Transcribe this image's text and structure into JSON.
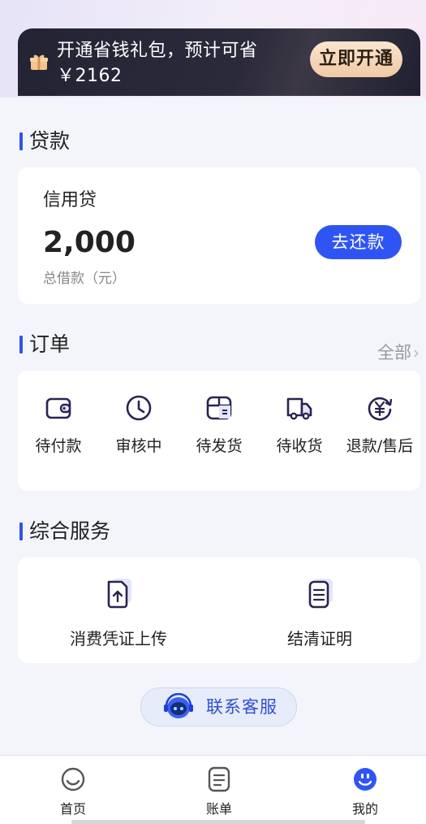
{
  "promo": {
    "text": "开通省钱礼包，预计可省￥2162",
    "button": "立即开通"
  },
  "loan": {
    "section_title": "贷款",
    "type": "信用贷",
    "amount": "2,000",
    "amount_label": "总借款（元）",
    "repay_button": "去还款"
  },
  "orders": {
    "section_title": "订单",
    "all_link": "全部",
    "items": [
      {
        "label": "待付款",
        "icon": "wallet-icon"
      },
      {
        "label": "审核中",
        "icon": "clock-icon"
      },
      {
        "label": "待发货",
        "icon": "box-icon"
      },
      {
        "label": "待收货",
        "icon": "truck-icon"
      },
      {
        "label": "退款/售后",
        "icon": "refund-icon"
      }
    ]
  },
  "services": {
    "section_title": "综合服务",
    "items": [
      {
        "label": "消费凭证上传",
        "icon": "upload-document-icon"
      },
      {
        "label": "结清证明",
        "icon": "certificate-document-icon"
      }
    ]
  },
  "customer_service": {
    "label": "联系客服"
  },
  "tabbar": {
    "items": [
      {
        "label": "首页",
        "icon": "home-icon"
      },
      {
        "label": "账单",
        "icon": "bill-icon"
      },
      {
        "label": "我的",
        "icon": "profile-icon",
        "active": true
      }
    ]
  },
  "colors": {
    "accent": "#2e55f4",
    "promo_bg": "#232433",
    "promo_button": "#f0c9a5",
    "icon_dark": "#2a2350"
  }
}
